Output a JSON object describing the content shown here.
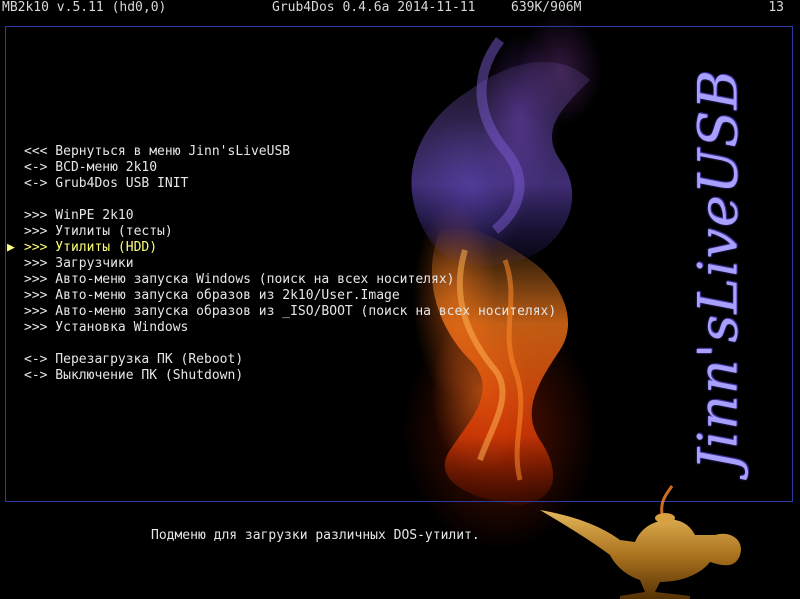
{
  "topbar": {
    "left": "MB2k10 v.5.11 (hd0,0)",
    "middle": "Grub4Dos 0.4.6a 2014-11-11",
    "memory": "639K/906M",
    "right": "13"
  },
  "menu": {
    "pointer": "▶",
    "group1": [
      {
        "label": "<<< Вернуться в меню Jinn'sLiveUSB"
      },
      {
        "label": "<-> BCD-меню 2k10"
      },
      {
        "label": "<-> Grub4Dos USB INIT"
      }
    ],
    "group2": [
      {
        "label": ">>> WinPE 2k10"
      },
      {
        "label": ">>> Утилиты (тесты)"
      },
      {
        "label": ">>> Утилиты (HDD)",
        "selected": true
      },
      {
        "label": ">>> Загрузчики"
      },
      {
        "label": ">>> Авто-меню запуска Windows (поиск на всех носителях)"
      },
      {
        "label": ">>> Авто-меню запуска образов из 2k10/User.Image"
      },
      {
        "label": ">>> Авто-меню запуска образов из _ISO/BOOT (поиск на всех носителях)"
      },
      {
        "label": ">>> Установка Windows"
      }
    ],
    "group3": [
      {
        "label": "<-> Перезагрузка ПК (Reboot)"
      },
      {
        "label": "<-> Выключение ПК (Shutdown)"
      }
    ]
  },
  "help_text": "Подменю для загрузки различных DOS-утилит.",
  "brand": {
    "text": "Jinn'sLiveUSB",
    "color": "#a7a0ff"
  },
  "icons": {
    "pointer": "triangle-right-icon",
    "lamp": "genie-lamp-icon"
  },
  "colors": {
    "background": "#000000",
    "frame": "#2c3aa8",
    "text": "#e6e6e6",
    "selected": "#ffff7a"
  }
}
